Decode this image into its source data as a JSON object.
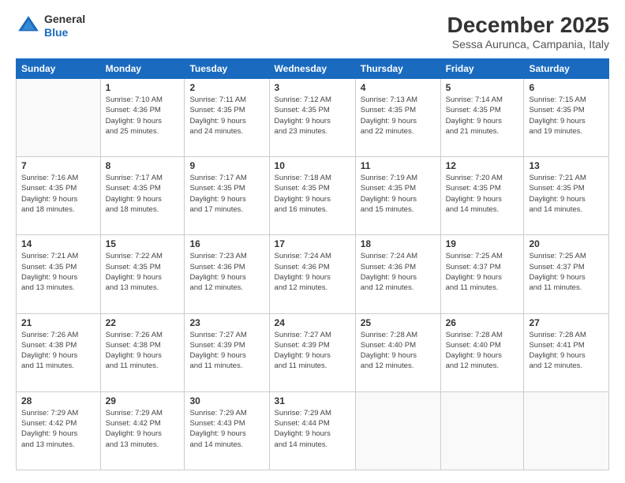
{
  "header": {
    "logo_line1": "General",
    "logo_line2": "Blue",
    "month": "December 2025",
    "location": "Sessa Aurunca, Campania, Italy"
  },
  "weekdays": [
    "Sunday",
    "Monday",
    "Tuesday",
    "Wednesday",
    "Thursday",
    "Friday",
    "Saturday"
  ],
  "weeks": [
    [
      {
        "day": "",
        "text": ""
      },
      {
        "day": "1",
        "text": "Sunrise: 7:10 AM\nSunset: 4:36 PM\nDaylight: 9 hours\nand 25 minutes."
      },
      {
        "day": "2",
        "text": "Sunrise: 7:11 AM\nSunset: 4:35 PM\nDaylight: 9 hours\nand 24 minutes."
      },
      {
        "day": "3",
        "text": "Sunrise: 7:12 AM\nSunset: 4:35 PM\nDaylight: 9 hours\nand 23 minutes."
      },
      {
        "day": "4",
        "text": "Sunrise: 7:13 AM\nSunset: 4:35 PM\nDaylight: 9 hours\nand 22 minutes."
      },
      {
        "day": "5",
        "text": "Sunrise: 7:14 AM\nSunset: 4:35 PM\nDaylight: 9 hours\nand 21 minutes."
      },
      {
        "day": "6",
        "text": "Sunrise: 7:15 AM\nSunset: 4:35 PM\nDaylight: 9 hours\nand 19 minutes."
      }
    ],
    [
      {
        "day": "7",
        "text": "Sunrise: 7:16 AM\nSunset: 4:35 PM\nDaylight: 9 hours\nand 18 minutes."
      },
      {
        "day": "8",
        "text": "Sunrise: 7:17 AM\nSunset: 4:35 PM\nDaylight: 9 hours\nand 18 minutes."
      },
      {
        "day": "9",
        "text": "Sunrise: 7:17 AM\nSunset: 4:35 PM\nDaylight: 9 hours\nand 17 minutes."
      },
      {
        "day": "10",
        "text": "Sunrise: 7:18 AM\nSunset: 4:35 PM\nDaylight: 9 hours\nand 16 minutes."
      },
      {
        "day": "11",
        "text": "Sunrise: 7:19 AM\nSunset: 4:35 PM\nDaylight: 9 hours\nand 15 minutes."
      },
      {
        "day": "12",
        "text": "Sunrise: 7:20 AM\nSunset: 4:35 PM\nDaylight: 9 hours\nand 14 minutes."
      },
      {
        "day": "13",
        "text": "Sunrise: 7:21 AM\nSunset: 4:35 PM\nDaylight: 9 hours\nand 14 minutes."
      }
    ],
    [
      {
        "day": "14",
        "text": "Sunrise: 7:21 AM\nSunset: 4:35 PM\nDaylight: 9 hours\nand 13 minutes."
      },
      {
        "day": "15",
        "text": "Sunrise: 7:22 AM\nSunset: 4:35 PM\nDaylight: 9 hours\nand 13 minutes."
      },
      {
        "day": "16",
        "text": "Sunrise: 7:23 AM\nSunset: 4:36 PM\nDaylight: 9 hours\nand 12 minutes."
      },
      {
        "day": "17",
        "text": "Sunrise: 7:24 AM\nSunset: 4:36 PM\nDaylight: 9 hours\nand 12 minutes."
      },
      {
        "day": "18",
        "text": "Sunrise: 7:24 AM\nSunset: 4:36 PM\nDaylight: 9 hours\nand 12 minutes."
      },
      {
        "day": "19",
        "text": "Sunrise: 7:25 AM\nSunset: 4:37 PM\nDaylight: 9 hours\nand 11 minutes."
      },
      {
        "day": "20",
        "text": "Sunrise: 7:25 AM\nSunset: 4:37 PM\nDaylight: 9 hours\nand 11 minutes."
      }
    ],
    [
      {
        "day": "21",
        "text": "Sunrise: 7:26 AM\nSunset: 4:38 PM\nDaylight: 9 hours\nand 11 minutes."
      },
      {
        "day": "22",
        "text": "Sunrise: 7:26 AM\nSunset: 4:38 PM\nDaylight: 9 hours\nand 11 minutes."
      },
      {
        "day": "23",
        "text": "Sunrise: 7:27 AM\nSunset: 4:39 PM\nDaylight: 9 hours\nand 11 minutes."
      },
      {
        "day": "24",
        "text": "Sunrise: 7:27 AM\nSunset: 4:39 PM\nDaylight: 9 hours\nand 11 minutes."
      },
      {
        "day": "25",
        "text": "Sunrise: 7:28 AM\nSunset: 4:40 PM\nDaylight: 9 hours\nand 12 minutes."
      },
      {
        "day": "26",
        "text": "Sunrise: 7:28 AM\nSunset: 4:40 PM\nDaylight: 9 hours\nand 12 minutes."
      },
      {
        "day": "27",
        "text": "Sunrise: 7:28 AM\nSunset: 4:41 PM\nDaylight: 9 hours\nand 12 minutes."
      }
    ],
    [
      {
        "day": "28",
        "text": "Sunrise: 7:29 AM\nSunset: 4:42 PM\nDaylight: 9 hours\nand 13 minutes."
      },
      {
        "day": "29",
        "text": "Sunrise: 7:29 AM\nSunset: 4:42 PM\nDaylight: 9 hours\nand 13 minutes."
      },
      {
        "day": "30",
        "text": "Sunrise: 7:29 AM\nSunset: 4:43 PM\nDaylight: 9 hours\nand 14 minutes."
      },
      {
        "day": "31",
        "text": "Sunrise: 7:29 AM\nSunset: 4:44 PM\nDaylight: 9 hours\nand 14 minutes."
      },
      {
        "day": "",
        "text": ""
      },
      {
        "day": "",
        "text": ""
      },
      {
        "day": "",
        "text": ""
      }
    ]
  ]
}
